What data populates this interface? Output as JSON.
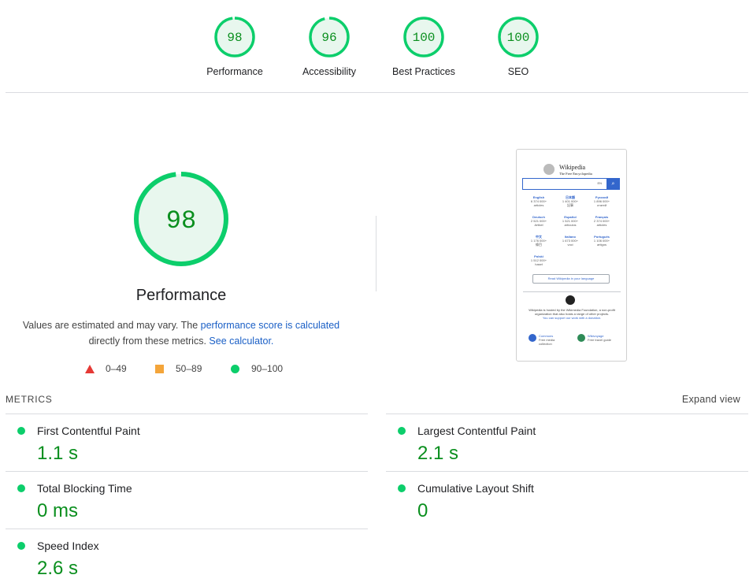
{
  "categories": [
    {
      "score": "98",
      "label": "Performance",
      "fraction": 0.98
    },
    {
      "score": "96",
      "label": "Accessibility",
      "fraction": 0.96
    },
    {
      "score": "100",
      "label": "Best Practices",
      "fraction": 1.0
    },
    {
      "score": "100",
      "label": "SEO",
      "fraction": 1.0
    }
  ],
  "colors": {
    "pass": "#0cce6b",
    "pass_fill": "#e8f7ee",
    "pass_text": "#0a8f1e",
    "fail": "#e53935",
    "average": "#f4a53a",
    "link": "#1a5fc6"
  },
  "performance": {
    "score": "98",
    "fraction": 0.98,
    "title": "Performance",
    "desc_prefix": "Values are estimated and may vary. The ",
    "desc_link": "performance score is calculated",
    "desc_mid": "directly from these metrics.",
    "desc_link2": "See calculator."
  },
  "legend": [
    {
      "icon": "triangle-fail-icon",
      "range": "0–49"
    },
    {
      "icon": "square-average-icon",
      "range": "50–89"
    },
    {
      "icon": "circle-pass-icon",
      "range": "90–100"
    }
  ],
  "thumbnail": {
    "name": "Wikipedia",
    "tagline": "The Free Encyclopedia",
    "search_lang": "EN",
    "languages": [
      {
        "name": "English",
        "count": "6 374 000+",
        "unit": "articles"
      },
      {
        "name": "日本語",
        "count": "1 401 000+",
        "unit": "記事"
      },
      {
        "name": "Русский",
        "count": "1 896 000+",
        "unit": "статей"
      },
      {
        "name": "Deutsch",
        "count": "2 521 000+",
        "unit": "Artikel"
      },
      {
        "name": "Español",
        "count": "1 521 000+",
        "unit": "artículos"
      },
      {
        "name": "Français",
        "count": "2 374 000+",
        "unit": "articles"
      },
      {
        "name": "中文",
        "count": "1 176 000+",
        "unit": "條目"
      },
      {
        "name": "Italiano",
        "count": "1 673 000+",
        "unit": "voci"
      },
      {
        "name": "Português",
        "count": "1 106 000+",
        "unit": "artigos"
      },
      {
        "name": "Polski",
        "count": "1 512 000+",
        "unit": "haseł"
      }
    ],
    "read_btn": "Read Wikipedia in your language",
    "foot1": "Wikipedia is hosted by the Wikimedia Foundation, a non-profit organization that also hosts a range of other projects.",
    "foot2": "You can support our work with a donation.",
    "proj1_name": "Commons",
    "proj1_desc": "Free media collection",
    "proj2_name": "Wikivoyage",
    "proj2_desc": "Free travel guide"
  },
  "metrics": {
    "header": "METRICS",
    "expand": "Expand view",
    "items": [
      {
        "name": "First Contentful Paint",
        "value": "1.1 s"
      },
      {
        "name": "Largest Contentful Paint",
        "value": "2.1 s"
      },
      {
        "name": "Total Blocking Time",
        "value": "0 ms"
      },
      {
        "name": "Cumulative Layout Shift",
        "value": "0"
      },
      {
        "name": "Speed Index",
        "value": "2.6 s"
      }
    ]
  }
}
